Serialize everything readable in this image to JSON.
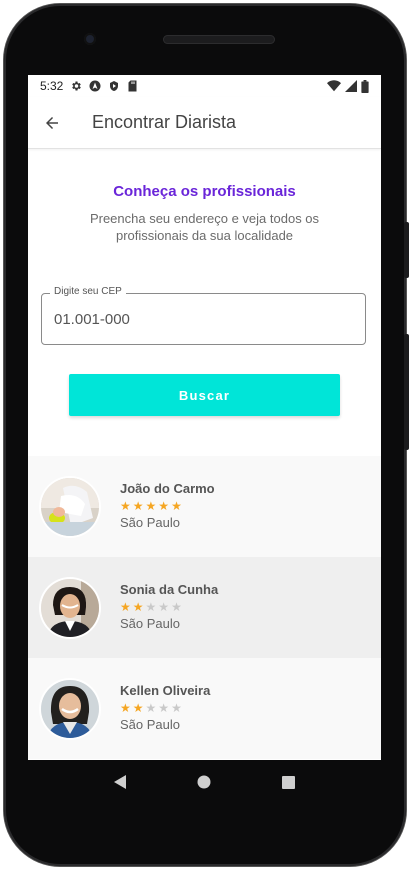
{
  "status": {
    "time": "5:32",
    "left_icons": [
      "settings-icon",
      "nav-arrow-icon",
      "shield-icon",
      "sd-card-icon"
    ],
    "right_icons": [
      "wifi-icon",
      "signal-icon",
      "battery-icon"
    ]
  },
  "appbar": {
    "title": "Encontrar Diarista",
    "back_icon": "arrow-left-icon"
  },
  "intro": {
    "title": "Conheça os profissionais",
    "subtitle": "Preencha seu endereço e veja todos os profissionais da sua localidade"
  },
  "search": {
    "label": "Digite seu CEP",
    "value": "01.001-000",
    "button_label": "Buscar"
  },
  "professionals": [
    {
      "name": "João do Carmo",
      "rating": 5,
      "max_rating": 5,
      "city": "São Paulo"
    },
    {
      "name": "Sonia da Cunha",
      "rating": 2,
      "max_rating": 5,
      "city": "São Paulo"
    },
    {
      "name": "Kellen Oliveira",
      "rating": 2,
      "max_rating": 5,
      "city": "São Paulo"
    }
  ],
  "colors": {
    "accent_purple": "#6a25d9",
    "button_cyan": "#00e5d8",
    "star_on": "#f5a623",
    "star_off": "#c9c9c9"
  }
}
